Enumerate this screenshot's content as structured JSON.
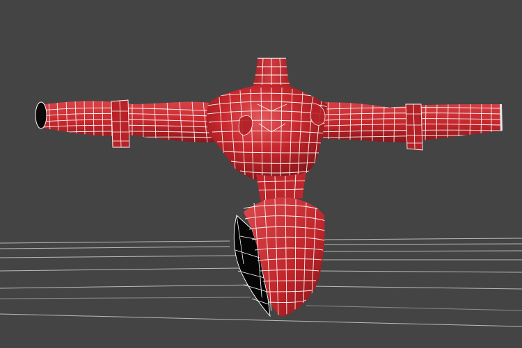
{
  "viewport": {
    "background_color": "#444444",
    "grid_color": "#d0d0d0",
    "mesh_fill_color": "#c8282d",
    "mesh_shadow_color": "#7e1418",
    "mesh_highlight_color": "#e06060",
    "wireframe_color": "#ffffff",
    "backface_color": "#050505",
    "object": "torso-mesh"
  }
}
